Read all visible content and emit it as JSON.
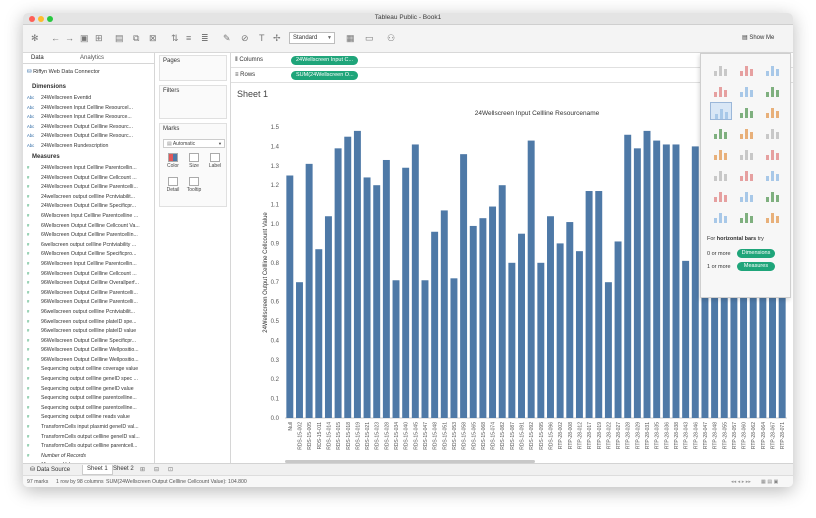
{
  "window": {
    "title": "Tableau Public - Book1"
  },
  "toolbar": {
    "fit_mode": "Standard",
    "show_me_label": "Show Me"
  },
  "left_panel": {
    "tabs": [
      "Data",
      "Analytics"
    ],
    "connection": "Riffyn Web Data Connector",
    "dimensions_header": "Dimensions",
    "dimensions": [
      "24Wellscreen Eventid",
      "24Wellscreen Input Cellline Resourcel...",
      "24Wellscreen Input Cellline Resource...",
      "24Wellscreen Output Cellline Resourc...",
      "24Wellscreen Output Cellline Resourc...",
      "24Wellscreen Rundescription"
    ],
    "measures_header": "Measures",
    "measures": [
      "24Wellscreen Input Cellline Parentcellin...",
      "24Wellscreen Output Cellline Cellcount ...",
      "24Wellscreen Output Cellline Parentcelli...",
      "24wellscreen output cellline Pcntviabilit...",
      "24Wellscreen Output Cellline Specificpr...",
      "6Wellscreen Input Cellline Parentcelline ...",
      "6Wellscreen Output Cellline Cellcount Va...",
      "6Wellscreen Output Cellline Parentcellin...",
      "6wellscreen output cellline Pcntviability ...",
      "6Wellscreen Output Cellline Specificpro...",
      "96Wellscreen Input Cellline Parentcellin...",
      "96Wellscreen Output Cellline Cellcount ...",
      "96Wellscreen Output Cellline Overallperf...",
      "96Wellscreen Output Cellline Parentcelli...",
      "96Wellscreen Output Cellline Parentcelli...",
      "96wellscreen output cellline Pcntviabilit...",
      "96wellscreen output cellline plateID spe...",
      "96wellscreen output cellline plateID value",
      "96Wellscreen Output Cellline Specificpr...",
      "96Wellscreen Output Cellline Wellpositio...",
      "96Wellscreen Output Cellline Wellpositio...",
      "Sequencing output cellline coverage value",
      "Sequencing output cellline geneID spec ...",
      "Sequencing output cellline geneID value",
      "Sequencing output cellline parentcelline...",
      "Sequencing output cellline parentcelline...",
      "Sequencing output cellline reads value",
      "TransformCells input plasmid geneID val...",
      "TransformCells output cellline geneID val...",
      "TransformCells output cellline parentcell...",
      "Number of Records",
      "Measure Values"
    ]
  },
  "cards": {
    "pages": "Pages",
    "filters": "Filters",
    "marks": "Marks",
    "marks_type": "Automatic",
    "mark_buttons": [
      "Color",
      "Size",
      "Label",
      "Detail",
      "Tooltip"
    ]
  },
  "shelves": {
    "columns_label": "Columns",
    "columns_pill": "24Wellscreen Input C...",
    "rows_label": "Rows",
    "rows_pill": "SUM(24Wellscreen O..."
  },
  "sheet": {
    "title": "Sheet 1"
  },
  "show_me": {
    "hint_prefix": "For",
    "hint_bold": "horizontal bars",
    "hint_suffix": "try",
    "req1_text": "0 or more",
    "req1_pill": "Dimensions",
    "req2_text": "1 or more",
    "req2_pill": "Measures"
  },
  "tabs": {
    "data_source": "Data Source",
    "sheets": [
      "Sheet 1",
      "Sheet 2"
    ]
  },
  "status": {
    "marks": "97 marks",
    "rows_cols": "1 row by 98 columns",
    "sum": "SUM(24Wellscreen Output Cellline Cellcount Value): 104.800"
  },
  "colors": {
    "bar": "#4e79a7",
    "pill": "#1fa57a",
    "accent": "#1f5f9e"
  },
  "chart_data": {
    "type": "bar",
    "title": "24Wellscreen Input Cellline Resourcename",
    "ylabel": "24Wellscreen Output Cellline Cellcount Value",
    "ylim": [
      0,
      1.5
    ],
    "yticks": [
      0.0,
      0.1,
      0.2,
      0.3,
      0.4,
      0.5,
      0.6,
      0.7,
      0.8,
      0.9,
      1.0,
      1.1,
      1.2,
      1.3,
      1.4,
      1.5
    ],
    "ytick_labels": [
      "0.0",
      "0.1",
      "0.2",
      "0.3",
      "0.4",
      "0.5",
      "0.6",
      "0.7",
      "0.8",
      "0.9",
      "1.0",
      "1.1",
      "1.2",
      "1.3",
      "1.4",
      "1.5"
    ],
    "categories": [
      "Null",
      "RDS-15-002",
      "RDS-15-005",
      "RDS-15-011",
      "RDS-15-014",
      "RDS-15-015",
      "RDS-15-018",
      "RDS-15-019",
      "RDS-15-021",
      "RDS-15-023",
      "RDS-15-028",
      "RDS-15-034",
      "RDS-15-040",
      "RDS-15-045",
      "RDS-15-047",
      "RDS-15-048",
      "RDS-15-051",
      "RDS-15-053",
      "RDS-15-058",
      "RDS-15-065",
      "RDS-15-068",
      "RDS-15-074",
      "RDS-15-082",
      "RDS-15-087",
      "RDS-15-091",
      "RDS-15-092",
      "RDS-15-095",
      "RDS-15-096",
      "RTP-28-002",
      "RTP-28-008",
      "RTP-28-012",
      "RTP-28-017",
      "RTP-28-019",
      "RTP-28-022",
      "RTP-28-027",
      "RTP-28-028",
      "RTP-28-029",
      "RTP-28-031",
      "RTP-28-035",
      "RTP-28-036",
      "RTP-28-038",
      "RTP-28-043",
      "RTP-28-046",
      "RTP-28-047",
      "RTP-28-048",
      "RTP-28-055",
      "RTP-28-057",
      "RTP-28-060",
      "RTP-28-062",
      "RTP-28-064",
      "RTP-28-067",
      "RTP-28-071"
    ],
    "values": [
      1.25,
      0.7,
      1.31,
      0.87,
      1.04,
      1.39,
      1.45,
      1.48,
      1.24,
      1.2,
      1.33,
      0.71,
      1.29,
      1.41,
      0.71,
      0.96,
      1.07,
      0.72,
      1.36,
      0.99,
      1.03,
      1.09,
      1.2,
      0.8,
      0.95,
      1.43,
      0.8,
      1.04,
      0.9,
      1.01,
      0.86,
      1.17,
      1.17,
      0.7,
      0.91,
      1.46,
      1.39,
      1.48,
      1.43,
      1.41,
      1.41,
      0.81,
      1.4,
      1.28,
      1.35,
      1.44,
      1.32,
      1.38,
      1.3,
      1.33,
      1.22,
      1.36
    ]
  }
}
